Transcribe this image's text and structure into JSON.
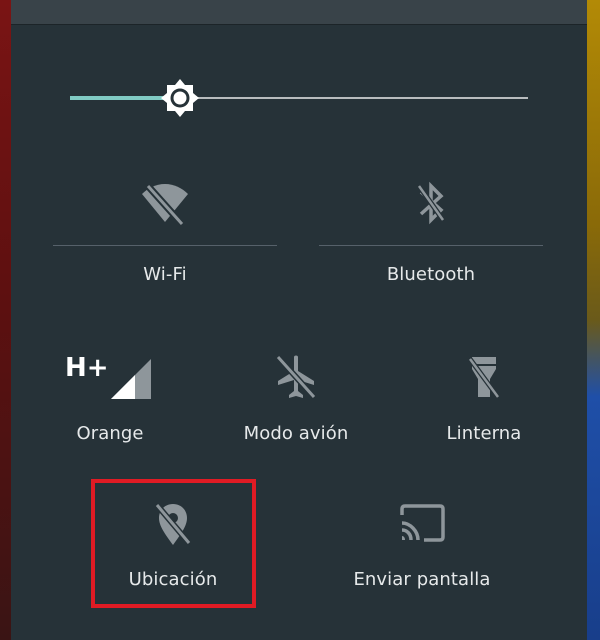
{
  "quick_settings": {
    "brightness": {
      "level_percent": 24
    },
    "tiles": {
      "wifi": {
        "label": "Wi-Fi",
        "icon": "wifi-off-icon"
      },
      "bluetooth": {
        "label": "Bluetooth",
        "icon": "bluetooth-off-icon"
      },
      "mobile": {
        "label": "Orange",
        "network_type": "H+",
        "icon": "cell-signal-icon"
      },
      "airplane": {
        "label": "Modo avión",
        "icon": "airplane-icon"
      },
      "flashlight": {
        "label": "Linterna",
        "icon": "flashlight-off-icon"
      },
      "location": {
        "label": "Ubicación",
        "icon": "location-off-icon"
      },
      "cast": {
        "label": "Enviar pantalla",
        "icon": "cast-icon"
      }
    }
  },
  "colors": {
    "panel_bg": "#263238",
    "accent": "#80cbc4",
    "highlight_border": "#e01b24",
    "disabled_icon": "#8e969b",
    "enabled_icon": "#ffffff"
  }
}
